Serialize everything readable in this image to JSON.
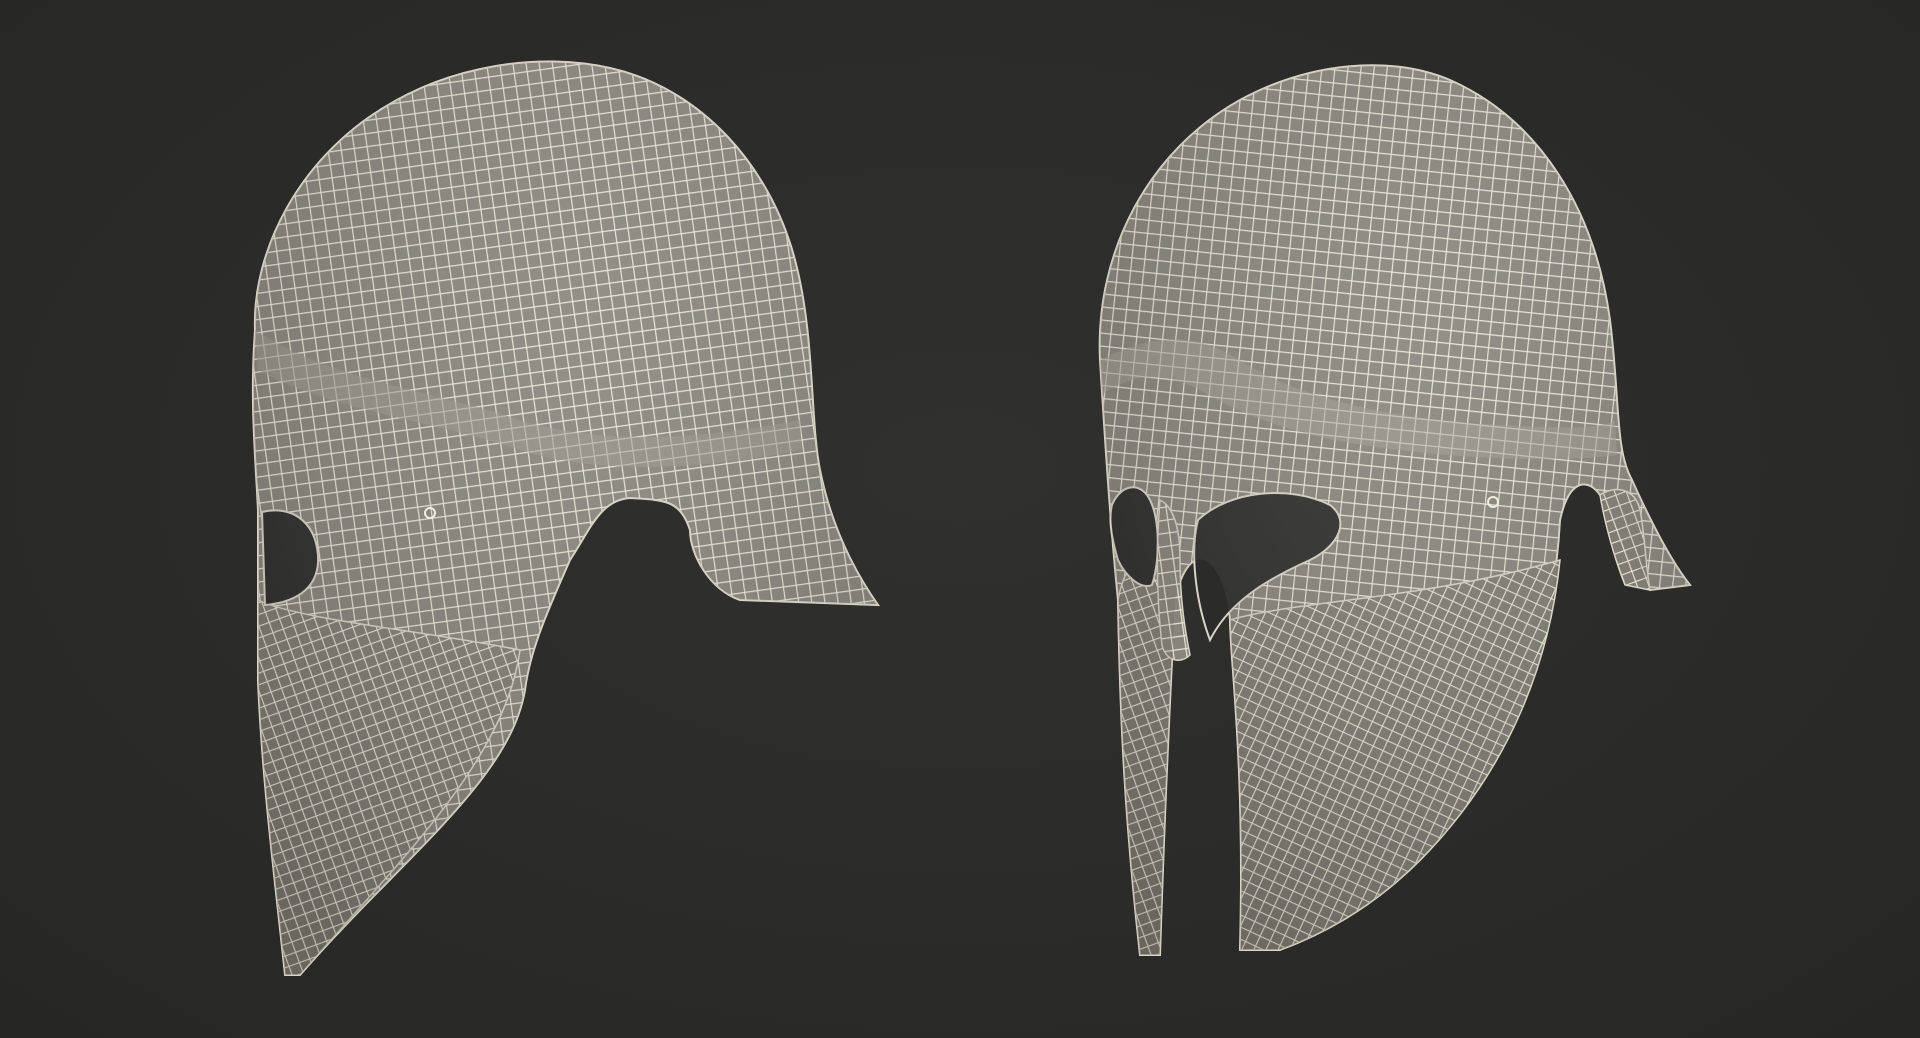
{
  "scene": {
    "background_color": "#2b2b29",
    "mesh_fill_color": "#86857b",
    "mesh_line_color": "#e9e6d7",
    "mesh_outline_color": "#d8d5c6",
    "opening_color": "#2b2b29"
  },
  "objects": [
    {
      "name": "helmet-side-view",
      "description_icon": "helmet-wireframe-icon"
    },
    {
      "name": "helmet-three-quarter-view",
      "description_icon": "helmet-wireframe-icon"
    }
  ]
}
